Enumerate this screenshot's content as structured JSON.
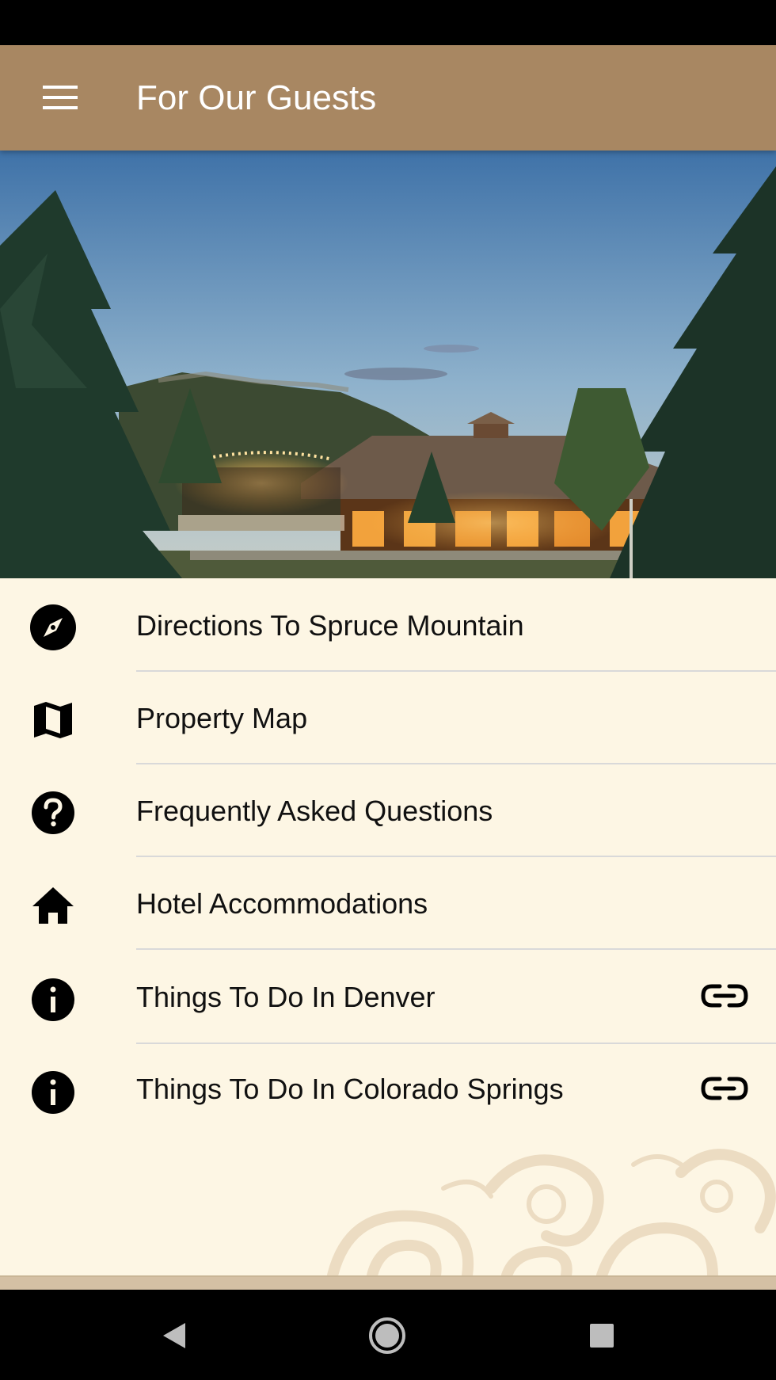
{
  "app_bar": {
    "title": "For Our Guests",
    "menu_icon": "hamburger-menu-icon",
    "background": "#a88762"
  },
  "hero": {
    "image": "lodge-at-dusk-photo"
  },
  "menu_items": [
    {
      "label": "Directions To Spruce Mountain",
      "icon": "compass-icon",
      "external_link": false
    },
    {
      "label": "Property Map",
      "icon": "map-icon",
      "external_link": false
    },
    {
      "label": "Frequently Asked Questions",
      "icon": "help-circle-icon",
      "external_link": false
    },
    {
      "label": "Hotel Accommodations",
      "icon": "home-icon",
      "external_link": false
    },
    {
      "label": "Things To Do In Denver",
      "icon": "info-icon",
      "external_link": true
    },
    {
      "label": "Things To Do In Colorado Springs",
      "icon": "info-icon",
      "external_link": true
    }
  ],
  "system_nav": {
    "back": "back-triangle-icon",
    "home": "home-circle-icon",
    "recents": "recents-square-icon"
  }
}
